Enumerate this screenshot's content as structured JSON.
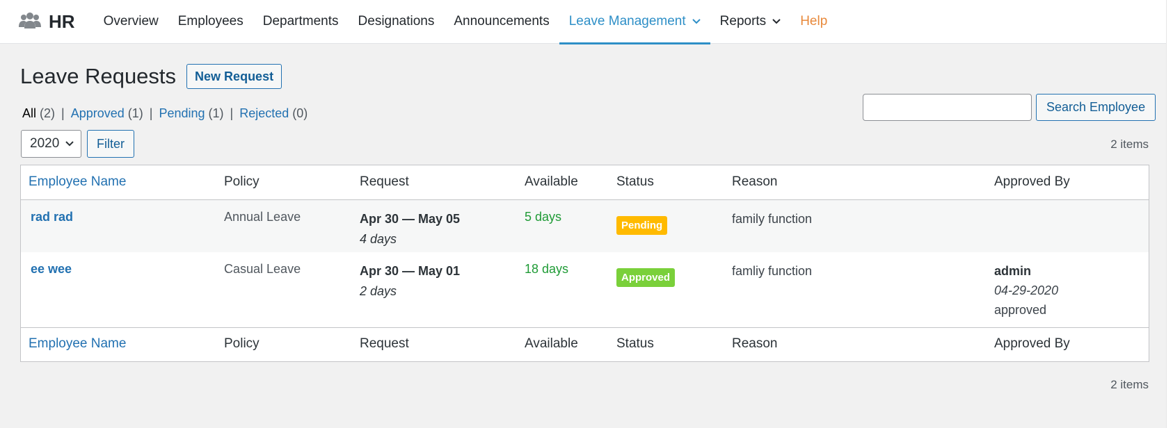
{
  "nav": {
    "brand": "HR",
    "items": [
      {
        "label": "Overview"
      },
      {
        "label": "Employees"
      },
      {
        "label": "Departments"
      },
      {
        "label": "Designations"
      },
      {
        "label": "Announcements"
      },
      {
        "label": "Leave Management",
        "active": true,
        "has_dropdown": true
      },
      {
        "label": "Reports",
        "has_dropdown": true
      },
      {
        "label": "Help"
      }
    ],
    "accent_color": "#2e8fc7",
    "help_color": "#e8893b"
  },
  "page": {
    "title": "Leave Requests",
    "new_request_label": "New Request"
  },
  "status_filters": [
    {
      "label": "All",
      "count": "(2)",
      "current": true
    },
    {
      "label": "Approved",
      "count": "(1)"
    },
    {
      "label": "Pending",
      "count": "(1)"
    },
    {
      "label": "Rejected",
      "count": "(0)"
    }
  ],
  "search": {
    "value": "",
    "button_label": "Search Employee"
  },
  "filter": {
    "year": "2020",
    "button_label": "Filter"
  },
  "items_count": "2 items",
  "table": {
    "columns": [
      "Employee Name",
      "Policy",
      "Request",
      "Available",
      "Status",
      "Reason",
      "Approved By"
    ],
    "rows": [
      {
        "employee": "rad rad",
        "policy": "Annual Leave",
        "request_range": "Apr 30 — May 05",
        "request_days": "4 days",
        "available": "5 days",
        "status": "Pending",
        "reason": "family function",
        "approved_by": "",
        "approved_date": "",
        "approved_note": ""
      },
      {
        "employee": "ee wee",
        "policy": "Casual Leave",
        "request_range": "Apr 30 — May 01",
        "request_days": "2 days",
        "available": "18 days",
        "status": "Approved",
        "reason": "famliy function",
        "approved_by": "admin",
        "approved_date": "04-29-2020",
        "approved_note": "approved"
      }
    ]
  },
  "colors": {
    "pending_badge": "#ffba00",
    "approved_badge": "#7ad03a",
    "available_text": "#1f9b36"
  }
}
